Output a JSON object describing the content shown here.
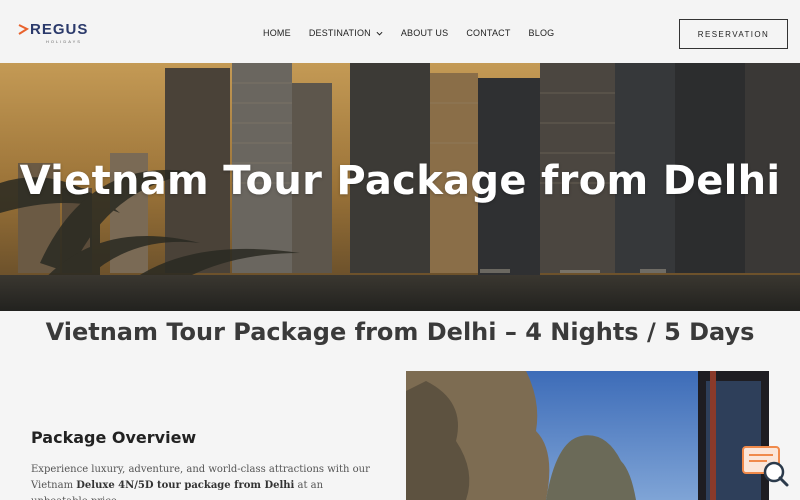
{
  "header": {
    "logo_text": "REGUS",
    "logo_sub": "HOLIDAYS",
    "nav": [
      {
        "label": "HOME"
      },
      {
        "label": "DESTINATION",
        "has_dropdown": true
      },
      {
        "label": "ABOUT US"
      },
      {
        "label": "CONTACT"
      },
      {
        "label": "BLOG"
      }
    ],
    "reservation_label": "RESERVATION"
  },
  "hero": {
    "title": "Vietnam Tour Package from Delhi"
  },
  "main": {
    "title": "Vietnam Tour Package from Delhi – 4 Nights / 5 Days",
    "section_heading": "Package Overview",
    "text_part1": "Experience luxury, adventure, and world-class attractions with our Vietnam ",
    "text_bold": "Deluxe 4N/5D tour package from Delhi",
    "text_part2": " at an unbeatable price."
  },
  "colors": {
    "brand_navy": "#2b3a6b",
    "brand_orange": "#e8622c",
    "chat_orange": "#f08a4b"
  },
  "icons": {
    "chevron": "chevron-down-icon",
    "chat": "chat-search-icon"
  }
}
